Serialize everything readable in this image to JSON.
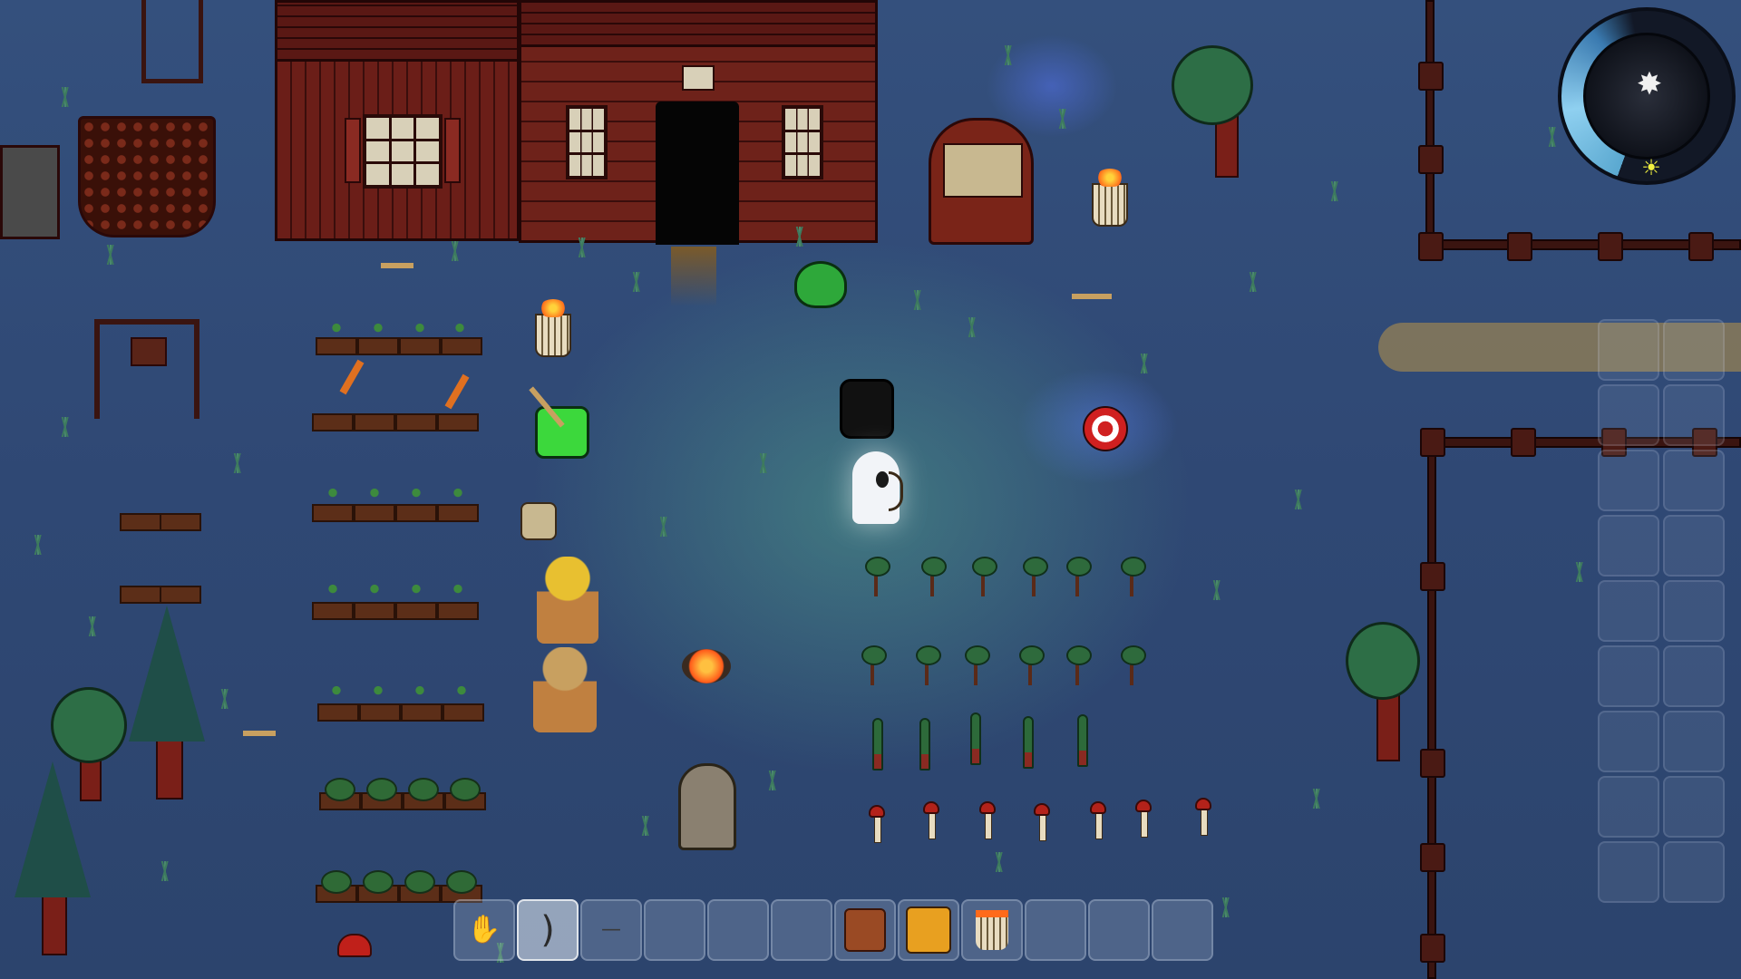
{
  "game": {
    "time_of_day": "night",
    "hotbar": {
      "selected_index": 1,
      "slots": [
        {
          "item": "hand-icon"
        },
        {
          "item": "bow-icon"
        },
        {
          "item": "arrow-icon"
        },
        {
          "item": ""
        },
        {
          "item": ""
        },
        {
          "item": ""
        },
        {
          "item": "wood-crate-icon"
        },
        {
          "item": "supply-crate-icon"
        },
        {
          "item": "brazier-icon"
        },
        {
          "item": ""
        },
        {
          "item": ""
        },
        {
          "item": ""
        }
      ]
    },
    "side_inventory": {
      "rows": 9,
      "cols": 2
    },
    "clock": {
      "moon_icon": "moon-icon",
      "sun_icon": "sun-icon"
    },
    "colors": {
      "grass": "#2f4874",
      "barn": "#6e221a",
      "fence": "#4a1a14",
      "light": "#50a08c"
    }
  }
}
